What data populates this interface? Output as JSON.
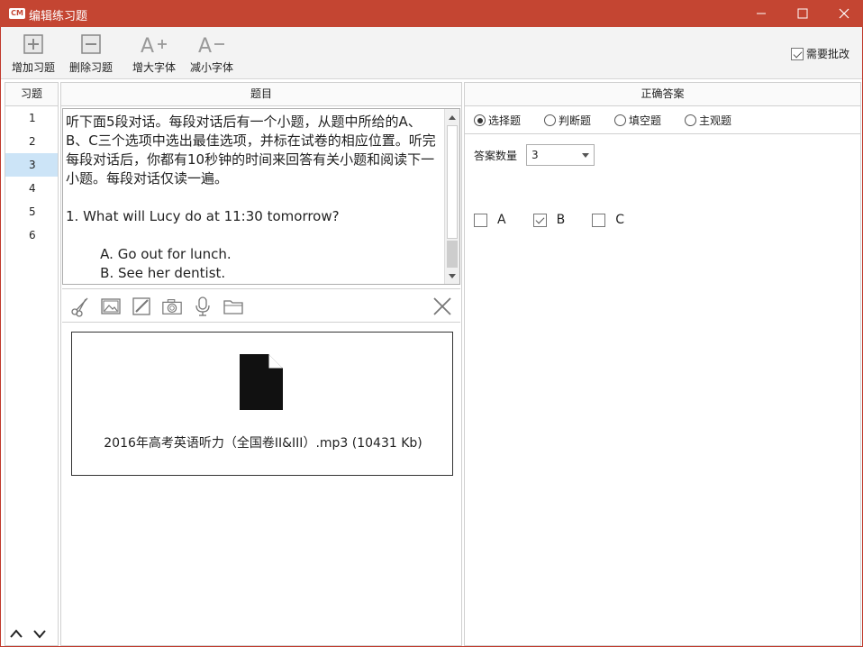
{
  "window": {
    "logo": "CM",
    "title": "编辑练习题"
  },
  "toolbar": {
    "buttons": [
      {
        "label": "增加习题",
        "icon": "add-icon"
      },
      {
        "label": "删除习题",
        "icon": "remove-icon"
      },
      {
        "label": "增大字体",
        "icon": "font-increase-icon"
      },
      {
        "label": "减小字体",
        "icon": "font-decrease-icon"
      }
    ],
    "review_label": "需要批改",
    "review_checked": true
  },
  "exercise_list": {
    "header": "习题",
    "items": [
      "1",
      "2",
      "3",
      "4",
      "5",
      "6"
    ],
    "selected": "3"
  },
  "question": {
    "header": "题目",
    "text": "听下面5段对话。每段对话后有一个小题，从题中所给的A、B、C三个选项中选出最佳选项，并标在试卷的相应位置。听完每段对话后，你都有10秒钟的时间来回答有关小题和阅读下一小题。每段对话仅读一遍。\n\n1. What will Lucy do at 11:30 tomorrow?\n\n        A. Go out for lunch.\n        B. See her dentist.",
    "attachment_tools": [
      "scissors-icon",
      "image-icon",
      "edit-icon",
      "camera-icon",
      "microphone-icon",
      "folder-icon"
    ],
    "attachment": {
      "file_name": "2016年高考英语听力（全国卷II&III）.mp3 (10431 Kb)"
    }
  },
  "answer": {
    "header": "正确答案",
    "types": [
      {
        "label": "选择题",
        "checked": true
      },
      {
        "label": "判断题",
        "checked": false
      },
      {
        "label": "填空题",
        "checked": false
      },
      {
        "label": "主观题",
        "checked": false
      }
    ],
    "count_label": "答案数量",
    "count_value": "3",
    "options": [
      {
        "label": "A",
        "checked": false
      },
      {
        "label": "B",
        "checked": true
      },
      {
        "label": "C",
        "checked": false
      }
    ]
  }
}
